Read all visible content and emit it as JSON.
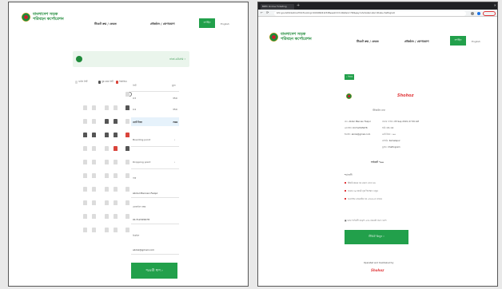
{
  "left": {
    "logo_text_line1": "বাংলাদেশ সড়ক",
    "logo_text_line2": "পরিবহন কর্পোরেশন",
    "nav1": "টিকেট ক্রয় / ফেরত",
    "nav2": "প্রতিষ্ঠান / যোগাযোগ",
    "btn": "লগইন",
    "small_link": "English",
    "route_text": "ঢাকা-চট্টগ্রাম ›",
    "legend": [
      "খালি সিট",
      "বুক করা সিট",
      "নির্বাচিত"
    ],
    "legend_colors": [
      "#dcdcdc",
      "#555555",
      "#d9443b"
    ],
    "table_header": [
      "সিট",
      "মূল্য"
    ],
    "table_rows": [
      {
        "seat": "C3",
        "fare": "350"
      },
      {
        "seat": "C4",
        "fare": "350"
      },
      {
        "seat": "মোট টাকা",
        "fare": "700"
      }
    ],
    "boarding_label": "Boarding point",
    "dropping_label": "Dropping point",
    "name_label": "নাম",
    "name_value": "Abdul Mannan Faiqul",
    "phone_label": "মোবাইল নম্বর",
    "phone_value": "01712345678",
    "email_label": "ইমেইল",
    "email_value": "abdul@gmail.com",
    "submit": "পরবর্তী ধাপ ›"
  },
  "right": {
    "browser_tab": "BRTC Online Ticketing",
    "url": "brtc.gov.bd/ticket/confirm?booking=2019090412345&seat=C3,C4&fare=700&pay=shohoz&route=dhaka-chattogram",
    "logo_text_line1": "বাংলাদেশ সড়ক",
    "logo_text_line2": "পরিবহন কর্পোরেশন",
    "nav1": "টিকেট ক্রয় / ফেরত",
    "nav2": "প্রতিষ্ঠান / যোগাযোগ",
    "btn": "লগইন",
    "small_link": "English",
    "back": "‹ ফিরে",
    "shohoz": "Shohoz",
    "invoice_title": "টিকিটের তথ্য",
    "info_left": [
      "নাম: Abdul Mannan Faiqul",
      "মোবাইল: 01712345678",
      "ইমেইল: abdul@gmail.com"
    ],
    "info_right": [
      "যাত্রার তারিখ: 05 Sep 2019, 07:30 AM",
      "সিট: C3, C4",
      "মোট টাকা: ৭০০",
      "বোর্ডিং: Kamalapur",
      "ড্রপিং: Chattogram"
    ],
    "total_label": "সর্বমোট ৭০০",
    "notes_title": "শর্তাবলী",
    "notes": [
      "টিকিট ক্রয়ের পর ফেরত যোগ্য নয়",
      "যাত্রার ৩০ মিনিট পূর্বে উপস্থিত থাকুন",
      "অনলাইন পেমেন্টের পর এসএমএস পাবেন"
    ],
    "agree_text": "আমি শর্তাবলী পড়েছি এবং পেমেন্টে সম্মত আছি",
    "pay_btn": "টিকিট কিনুন ›",
    "powered_by": "Operated and maintained by",
    "powered_logo": "Shohoz"
  }
}
